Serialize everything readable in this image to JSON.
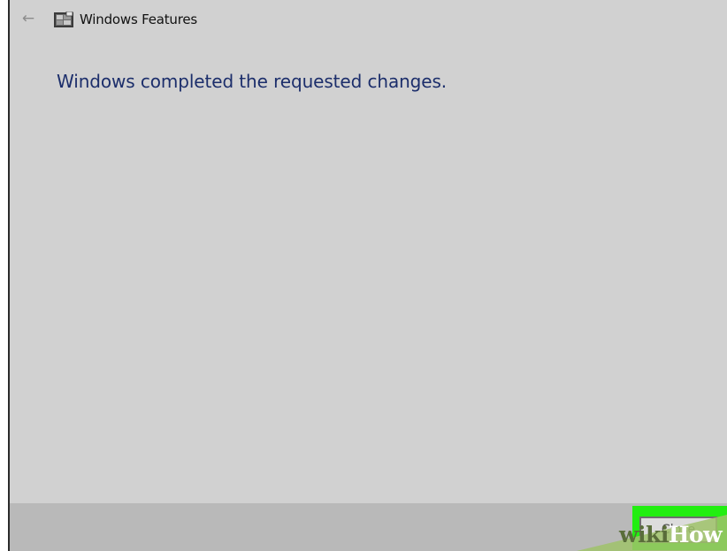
{
  "window": {
    "title": "Windows Features",
    "back_icon": "back-arrow-icon",
    "app_icon": "windows-features-icon"
  },
  "main": {
    "heading": "Windows completed the requested changes."
  },
  "footer": {
    "close_label": "Close",
    "highlight_color": "#22ee11"
  },
  "watermark": {
    "wiki": "wiki",
    "how": "How"
  }
}
